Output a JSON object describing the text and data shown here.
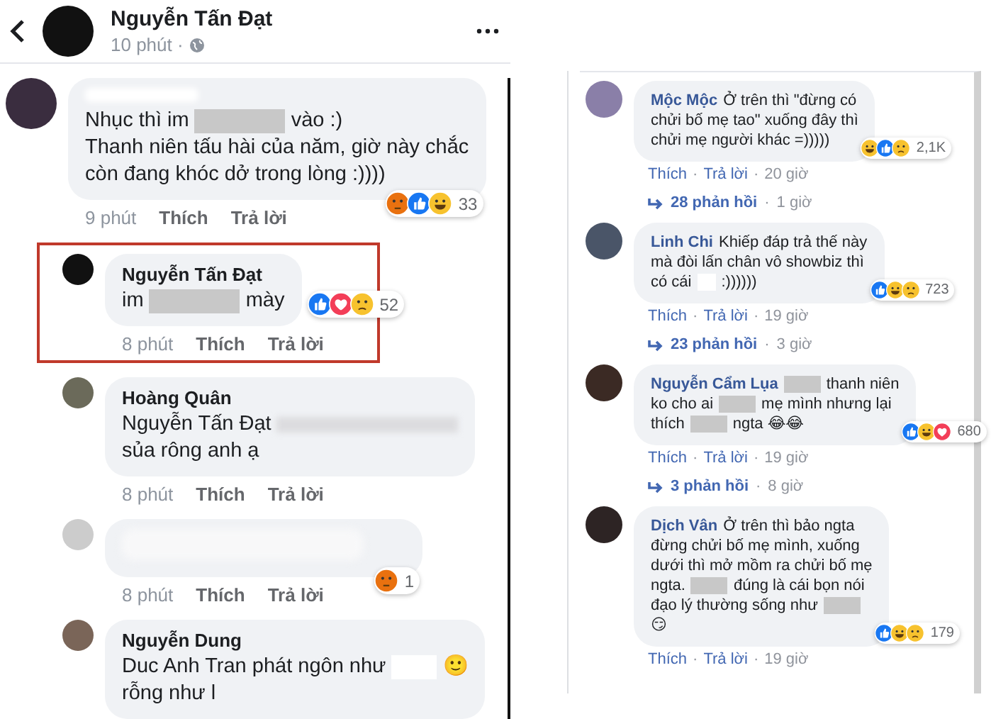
{
  "header": {
    "author": "Nguyễn Tấn Đạt",
    "time": "10 phút ·"
  },
  "left_comments": [
    {
      "reply": false,
      "highlighted": false,
      "name_blurred": true,
      "blurred": false,
      "lines": [
        [
          {
            "kind": "text",
            "text": "Nhục thì im"
          },
          {
            "kind": "redacted"
          },
          {
            "kind": "text",
            "text": "vào :)"
          }
        ],
        [
          {
            "kind": "text",
            "text": "Thanh niên tấu hài của năm, giờ này chắc"
          }
        ],
        [
          {
            "kind": "text",
            "text": "còn đang khóc dở trong lòng :))))"
          }
        ]
      ],
      "meta": {
        "time": "9 phút",
        "like": "Thích",
        "reply": "Trả lời"
      },
      "reactions": {
        "icons": [
          {
            "kind": "angry"
          },
          {
            "kind": "like"
          },
          {
            "kind": "haha"
          }
        ],
        "count": "33"
      }
    },
    {
      "reply": true,
      "highlighted": true,
      "author": "Nguyễn Tấn Đạt",
      "name_blurred": false,
      "blurred": false,
      "lines": [
        [
          {
            "kind": "text",
            "text": "im"
          },
          {
            "kind": "redacted"
          },
          {
            "kind": "text",
            "text": "mày"
          }
        ]
      ],
      "meta": {
        "time": "8 phút",
        "like": "Thích",
        "reply": "Trả lời"
      },
      "reactions": {
        "icons": [
          {
            "kind": "like"
          },
          {
            "kind": "love"
          },
          {
            "kind": "sad"
          }
        ],
        "count": "52"
      }
    },
    {
      "reply": true,
      "highlighted": false,
      "author": "Hoàng Quân",
      "name_blurred": false,
      "blurred": false,
      "lines": [
        [
          {
            "kind": "text",
            "text": "Nguyễn Tấn Đạt"
          },
          {
            "kind": "blurred"
          }
        ],
        [
          {
            "kind": "text",
            "text": "sủa rông anh ạ"
          }
        ]
      ],
      "meta": {
        "time": "8 phút",
        "like": "Thích",
        "reply": "Trả lời"
      }
    },
    {
      "reply": true,
      "highlighted": false,
      "name_blurred": false,
      "blurred": true,
      "meta": {
        "time": "8 phút",
        "like": "Thích",
        "reply": "Trả lời"
      },
      "reactions": {
        "icons": [
          {
            "kind": "angry"
          }
        ],
        "count": "1"
      }
    },
    {
      "reply": true,
      "highlighted": false,
      "author": "Nguyễn Dung",
      "name_blurred": false,
      "blurred": false,
      "lines": [
        [
          {
            "kind": "text",
            "text": "Duc Anh Tran phát ngôn như"
          },
          {
            "kind": "whiteout"
          },
          {
            "kind": "text",
            "text": "🙂"
          }
        ],
        [
          {
            "kind": "text",
            "text": "rỗng như l"
          }
        ]
      ]
    }
  ],
  "right_comments": [
    {
      "author": "Mộc Mộc",
      "lines": [
        [
          {
            "kind": "text",
            "text": "Ở trên thì \"đừng có"
          }
        ],
        [
          {
            "kind": "text",
            "text": "chửi bố mẹ tao\" xuống đây thì"
          }
        ],
        [
          {
            "kind": "text",
            "text": "chửi mẹ người khác =)))))"
          }
        ]
      ],
      "reactions": {
        "icons": [
          {
            "kind": "haha"
          },
          {
            "kind": "like"
          },
          {
            "kind": "sad"
          }
        ],
        "count": "2,1K"
      },
      "meta": [
        {
          "kind": "link",
          "text": "Thích"
        },
        {
          "kind": "sep",
          "text": "·"
        },
        {
          "kind": "link",
          "text": "Trả lời"
        },
        {
          "kind": "sep",
          "text": "·"
        },
        {
          "kind": "time",
          "text": "20 giờ"
        }
      ],
      "replies": {
        "text": "28 phản hồi",
        "separator": "·",
        "time": "1 giờ"
      }
    },
    {
      "author": "Linh Chi",
      "lines": [
        [
          {
            "kind": "text",
            "text": "Khiếp đáp trả thế này"
          }
        ],
        [
          {
            "kind": "text",
            "text": "mà đòi lấn chân vô showbiz thì"
          }
        ],
        [
          {
            "kind": "text",
            "text": "có cái"
          },
          {
            "kind": "whiteout"
          },
          {
            "kind": "text",
            "text": ":))))))"
          }
        ]
      ],
      "reactions": {
        "icons": [
          {
            "kind": "like"
          },
          {
            "kind": "haha"
          },
          {
            "kind": "sad"
          }
        ],
        "count": "723"
      },
      "meta": [
        {
          "kind": "link",
          "text": "Thích"
        },
        {
          "kind": "sep",
          "text": "·"
        },
        {
          "kind": "link",
          "text": "Trả lời"
        },
        {
          "kind": "sep",
          "text": "·"
        },
        {
          "kind": "time",
          "text": "19 giờ"
        }
      ],
      "replies": {
        "text": "23 phản hồi",
        "separator": "·",
        "time": "3 giờ"
      }
    },
    {
      "author": "Nguyễn Cẩm Lụa",
      "lines": [
        [
          {
            "kind": "redacted"
          },
          {
            "kind": "text",
            "text": "thanh niên"
          }
        ],
        [
          {
            "kind": "text",
            "text": "ko cho ai"
          },
          {
            "kind": "redacted"
          },
          {
            "kind": "text",
            "text": "mẹ mình nhưng lại"
          }
        ],
        [
          {
            "kind": "text",
            "text": "thích"
          },
          {
            "kind": "redacted"
          },
          {
            "kind": "text",
            "text": "ngta 😂😂"
          }
        ]
      ],
      "reactions": {
        "icons": [
          {
            "kind": "like"
          },
          {
            "kind": "haha"
          },
          {
            "kind": "love"
          }
        ],
        "count": "680"
      },
      "meta": [
        {
          "kind": "link",
          "text": "Thích"
        },
        {
          "kind": "sep",
          "text": "·"
        },
        {
          "kind": "link",
          "text": "Trả lời"
        },
        {
          "kind": "sep",
          "text": "·"
        },
        {
          "kind": "time",
          "text": "19 giờ"
        }
      ],
      "replies": {
        "text": "3 phản hồi",
        "separator": "·",
        "time": "8 giờ"
      }
    },
    {
      "author": "Dịch Vân",
      "lines": [
        [
          {
            "kind": "text",
            "text": "Ở trên thì bảo ngta"
          }
        ],
        [
          {
            "kind": "text",
            "text": "đừng chửi bố mẹ mình, xuống"
          }
        ],
        [
          {
            "kind": "text",
            "text": "dưới thì mở mồm ra chửi bố mẹ"
          }
        ],
        [
          {
            "kind": "text",
            "text": "ngta."
          },
          {
            "kind": "redacted"
          },
          {
            "kind": "text",
            "text": "đúng là cái bọn nói"
          }
        ],
        [
          {
            "kind": "text",
            "text": "đạo lý thường sống như"
          },
          {
            "kind": "redacted"
          }
        ],
        [
          {
            "kind": "text",
            "text": "😏"
          }
        ]
      ],
      "reactions": {
        "icons": [
          {
            "kind": "like"
          },
          {
            "kind": "haha"
          },
          {
            "kind": "sad"
          }
        ],
        "count": "179"
      },
      "meta": [
        {
          "kind": "link",
          "text": "Thích"
        },
        {
          "kind": "sep",
          "text": "·"
        },
        {
          "kind": "link",
          "text": "Trả lời"
        },
        {
          "kind": "sep",
          "text": "·"
        },
        {
          "kind": "time",
          "text": "19 giờ"
        }
      ]
    }
  ]
}
